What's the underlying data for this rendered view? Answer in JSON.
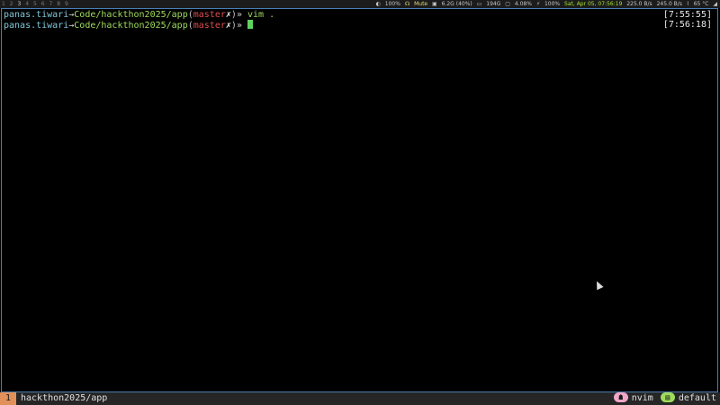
{
  "topbar": {
    "workspaces": [
      "1",
      "2",
      "3",
      "4",
      "5",
      "6",
      "7",
      "8",
      "9"
    ],
    "active_workspace": "3",
    "status": {
      "volume": "100%",
      "mic": "Mute",
      "memory": "6.2G (40%)",
      "disk": "194G",
      "cpu": "4.08%",
      "battery": "100%",
      "datetime": "Sat, Apr 05, 07:56:19",
      "net_down": "225.0 B/s",
      "net_up": "245.0 B/s",
      "temp": "65 °C"
    }
  },
  "terminal": {
    "lines": [
      {
        "user": "panas.tiwari",
        "sep": "→",
        "dir": "Code/hackthon2025/app",
        "branch": "master",
        "dirty": "✗",
        "prompt": "»",
        "command": "vim .",
        "time": "[7:55:55]"
      },
      {
        "user": "panas.tiwari",
        "sep": "→",
        "dir": "Code/hackthon2025/app",
        "branch": "master",
        "dirty": "✗",
        "prompt": "»",
        "command": "",
        "time": "[7:56:18]"
      }
    ]
  },
  "tmux": {
    "window_index": "1",
    "window_name": "hackthon2025/app",
    "nvim_label": "nvim",
    "session_label": "default"
  },
  "colors": {
    "border": "#4a7fb5",
    "cursor": "#5fd35f",
    "branch": "#e24a4a",
    "dir": "#9fdc5c",
    "user": "#7fc6d8"
  }
}
